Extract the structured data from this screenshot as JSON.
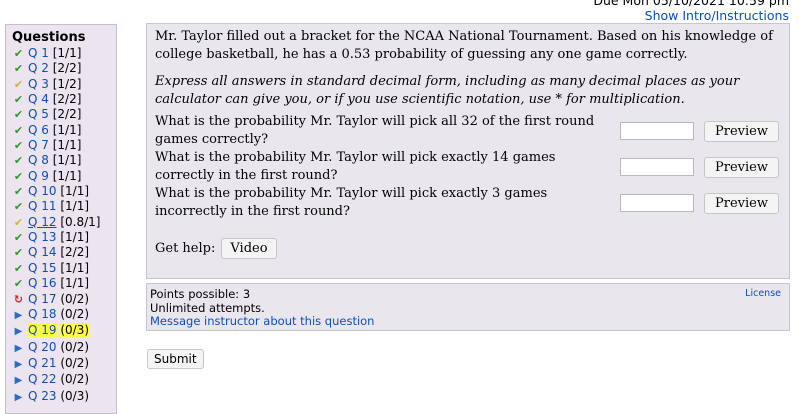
{
  "header": {
    "due": "Due Mon 05/10/2021 10:59 pm",
    "show_intro": "Show Intro/Instructions"
  },
  "sidebar": {
    "title": "Questions",
    "items": [
      {
        "label": "Q 1",
        "score": "[1/1]",
        "status": "correct"
      },
      {
        "label": "Q 2",
        "score": "[2/2]",
        "status": "correct"
      },
      {
        "label": "Q 3",
        "score": "[1/2]",
        "status": "partial"
      },
      {
        "label": "Q 4",
        "score": "[2/2]",
        "status": "correct"
      },
      {
        "label": "Q 5",
        "score": "[2/2]",
        "status": "correct"
      },
      {
        "label": "Q 6",
        "score": "[1/1]",
        "status": "correct"
      },
      {
        "label": "Q 7",
        "score": "[1/1]",
        "status": "correct"
      },
      {
        "label": "Q 8",
        "score": "[1/1]",
        "status": "correct"
      },
      {
        "label": "Q 9",
        "score": "[1/1]",
        "status": "correct"
      },
      {
        "label": "Q 10",
        "score": "[1/1]",
        "status": "correct"
      },
      {
        "label": "Q 11",
        "score": "[1/1]",
        "status": "correct"
      },
      {
        "label": "Q 12",
        "score": "[0.8/1]",
        "status": "partial"
      },
      {
        "label": "Q 13",
        "score": "[1/1]",
        "status": "correct"
      },
      {
        "label": "Q 14",
        "score": "[2/2]",
        "status": "correct"
      },
      {
        "label": "Q 15",
        "score": "[1/1]",
        "status": "correct"
      },
      {
        "label": "Q 16",
        "score": "[1/1]",
        "status": "correct"
      },
      {
        "label": "Q 17",
        "score": "(0/2)",
        "status": "retry"
      },
      {
        "label": "Q 18",
        "score": "(0/2)",
        "status": "open"
      },
      {
        "label": "Q 19",
        "score": "(0/3)",
        "status": "open"
      },
      {
        "label": "Q 20",
        "score": "(0/2)",
        "status": "open"
      },
      {
        "label": "Q 21",
        "score": "(0/2)",
        "status": "open"
      },
      {
        "label": "Q 22",
        "score": "(0/2)",
        "status": "open"
      },
      {
        "label": "Q 23",
        "score": "(0/3)",
        "status": "open"
      }
    ]
  },
  "question": {
    "intro": "Mr. Taylor filled out a bracket for the NCAA National Tournament. Based on his knowledge of college basketball, he has a 0.53 probability of guessing any one game correctly.",
    "instructions": "Express all answers in standard decimal form, including as many decimal places as your calculator can give you, or if you use scientific notation, use * for multiplication.",
    "parts": [
      {
        "text": "What is the probability Mr. Taylor will pick all 32 of the first round games correctly?",
        "value": "",
        "button": "Preview"
      },
      {
        "text": "What is the probability Mr. Taylor will pick exactly 14 games correctly in the first round?",
        "value": "",
        "button": "Preview"
      },
      {
        "text": "What is the probability Mr. Taylor will pick exactly 3 games incorrectly in the first round?",
        "value": "",
        "button": "Preview"
      }
    ],
    "help_label": "Get help:",
    "help_button": "Video"
  },
  "info": {
    "points": "Points possible: 3",
    "attempts": "Unlimited attempts.",
    "message_link": "Message instructor about this question",
    "license": "License"
  },
  "submit_label": "Submit",
  "colors": {
    "link": "#0c4fbf",
    "correct": "#2e9a2e",
    "partial": "#d2b33c",
    "retry": "#d52a1f",
    "open": "#2c6cc6",
    "highlight": "#ffff40"
  }
}
